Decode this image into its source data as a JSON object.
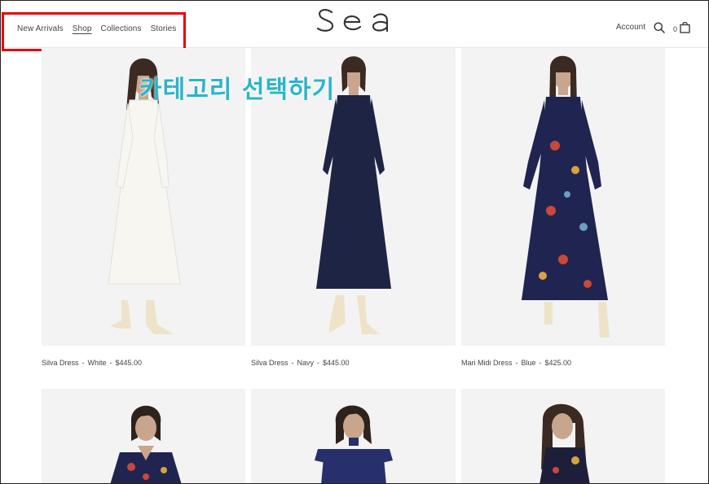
{
  "nav": {
    "items": [
      {
        "label": "New Arrivals",
        "active": false
      },
      {
        "label": "Shop",
        "active": true
      },
      {
        "label": "Collections",
        "active": false
      },
      {
        "label": "Stories",
        "active": false
      }
    ]
  },
  "brand": {
    "logo_text": "Sea"
  },
  "header": {
    "account_label": "Account",
    "cart_count": "0",
    "search_icon": "search-icon",
    "cart_icon": "shopping-bag-icon"
  },
  "overlay": {
    "caption": "카테고리 선택하기",
    "color": "#2ab5ca",
    "highlight_color": "#e8000b"
  },
  "products": [
    {
      "name": "Silva Dress",
      "color": "White",
      "price": "$445.00",
      "dress_color": "#f7f6f1"
    },
    {
      "name": "Silva Dress",
      "color": "Navy",
      "price": "$445.00",
      "dress_color": "#1e2544"
    },
    {
      "name": "Mari Midi Dress",
      "color": "Blue",
      "price": "$425.00",
      "dress_color": "#1f2550"
    },
    {
      "name": "",
      "color": "",
      "price": "",
      "dress_color": "#1f2550"
    },
    {
      "name": "",
      "color": "",
      "price": "",
      "dress_color": "#27306a"
    },
    {
      "name": "",
      "color": "",
      "price": "",
      "dress_color": "#1d1f3a"
    }
  ]
}
